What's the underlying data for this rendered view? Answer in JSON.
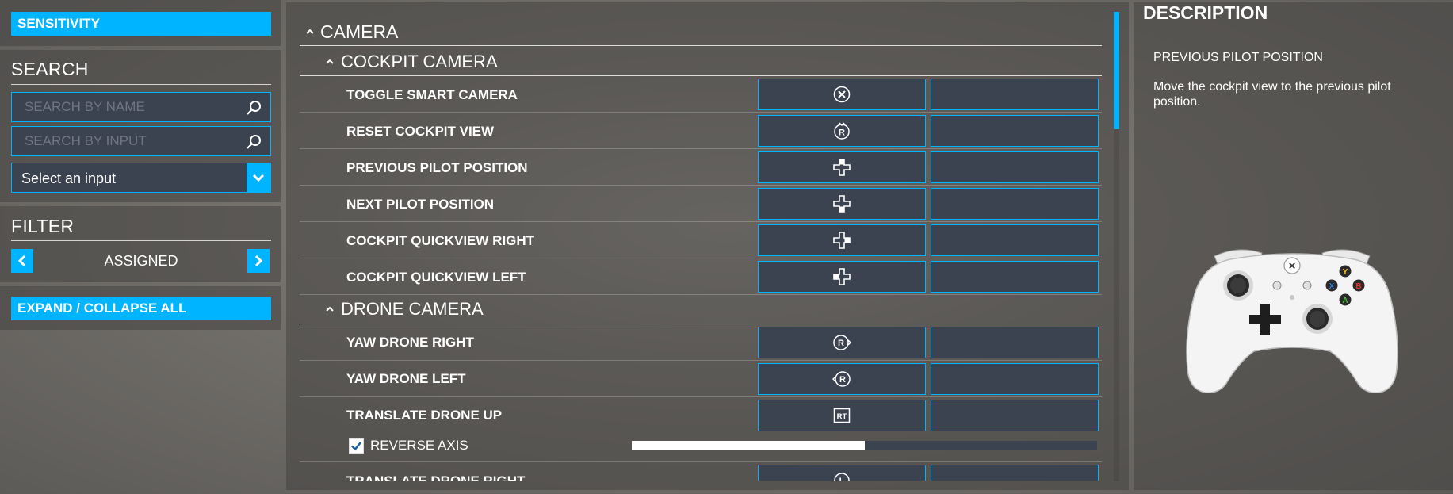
{
  "left": {
    "sensitivity_label": "SENSITIVITY",
    "search_title": "SEARCH",
    "search_by_name_placeholder": "SEARCH BY NAME",
    "search_by_input_placeholder": "SEARCH BY INPUT",
    "select_input_value": "Select an input",
    "filter_title": "FILTER",
    "filter_value": "ASSIGNED",
    "expand_collapse_label": "EXPAND / COLLAPSE ALL"
  },
  "camera": {
    "title": "CAMERA",
    "cockpit": {
      "title": "COCKPIT CAMERA",
      "rows": [
        {
          "label": "TOGGLE SMART CAMERA",
          "icon": "x-button-icon"
        },
        {
          "label": "RESET COCKPIT VIEW",
          "icon": "right-stick-press-icon"
        },
        {
          "label": "PREVIOUS PILOT POSITION",
          "icon": "dpad-icon"
        },
        {
          "label": "NEXT PILOT POSITION",
          "icon": "dpad-icon"
        },
        {
          "label": "COCKPIT QUICKVIEW RIGHT",
          "icon": "dpad-icon"
        },
        {
          "label": "COCKPIT QUICKVIEW LEFT",
          "icon": "dpad-icon"
        }
      ]
    },
    "drone": {
      "title": "DRONE CAMERA",
      "rows": [
        {
          "label": "YAW DRONE RIGHT",
          "icon": "right-stick-right-icon"
        },
        {
          "label": "YAW DRONE LEFT",
          "icon": "right-stick-left-icon"
        },
        {
          "label": "TRANSLATE DRONE UP",
          "icon": "rt-trigger-icon",
          "icon_text": "RT"
        },
        {
          "label": "TRANSLATE DRONE RIGHT",
          "icon": "left-stick-icon"
        }
      ],
      "reverse_axis_label": "REVERSE AXIS",
      "reverse_axis_checked": true,
      "slider_fraction": 0.5
    }
  },
  "description": {
    "title": "DESCRIPTION",
    "action_name": "PREVIOUS PILOT POSITION",
    "text": "Move the cockpit view to the previous pilot position."
  },
  "colors": {
    "accent": "#00b4ff",
    "field_bg": "#3c4350"
  }
}
